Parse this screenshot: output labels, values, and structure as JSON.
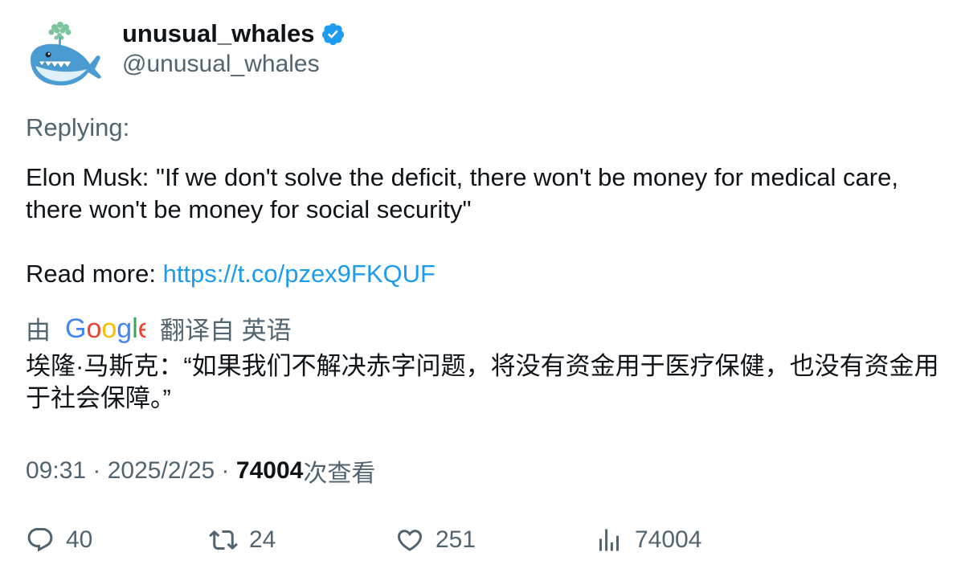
{
  "author": {
    "display_name": "unusual_whales",
    "handle": "@unusual_whales",
    "verified": true,
    "avatar_icon": "whale-avatar-icon"
  },
  "tweet": {
    "replying_label": "Replying:",
    "text_line_1": "Elon Musk: \"If we don't solve the deficit, there won't be money for medical care, there won't be money for social security\"",
    "read_more_label": "Read more: ",
    "link": "https://t.co/pzex9FKQUF"
  },
  "translation": {
    "by_label": "由",
    "provider": "Google",
    "from_label": "翻译自 英语",
    "translated_text": "埃隆·马斯克：“如果我们不解决赤字问题，将没有资金用于医疗保健，也没有资金用于社会保障。”"
  },
  "meta": {
    "time": "09:31",
    "separator": " · ",
    "date": "2025/2/25",
    "views_count": "74004",
    "views_label": "次查看"
  },
  "actions": {
    "replies": "40",
    "retweets": "24",
    "likes": "251",
    "views": "74004"
  },
  "colors": {
    "accent": "#1d9bf0",
    "text": "#0f1419",
    "muted": "#536471"
  }
}
